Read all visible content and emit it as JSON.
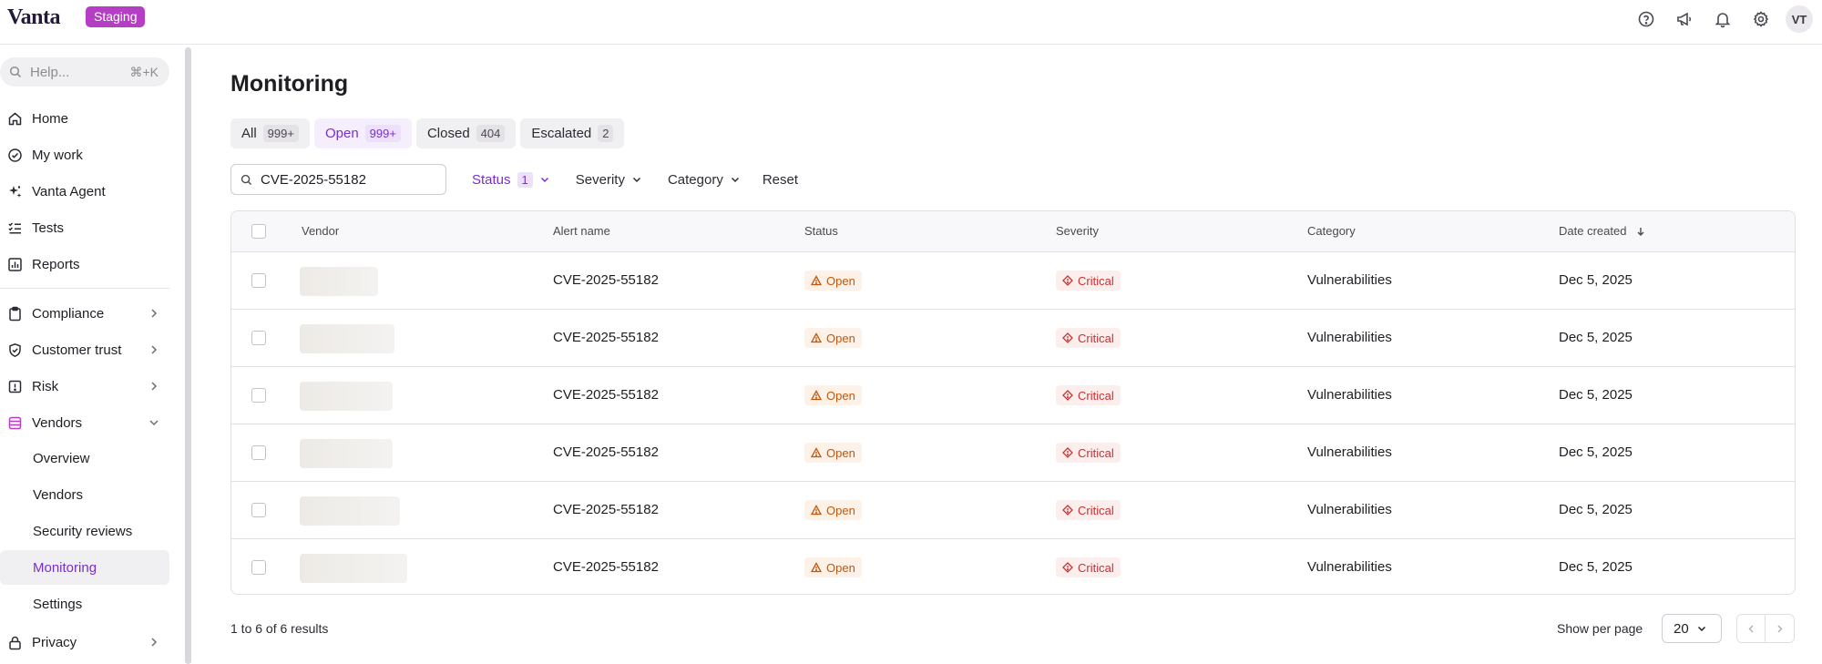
{
  "app": {
    "logo": "Vanta",
    "env_badge": "Staging",
    "avatar_initials": "VT"
  },
  "topbar_icons": [
    "help-icon",
    "megaphone-icon",
    "bell-icon",
    "gear-icon"
  ],
  "sidebar": {
    "search_placeholder": "Help...",
    "search_shortcut": "⌘+K",
    "items": [
      {
        "label": "Home",
        "icon": "home-icon"
      },
      {
        "label": "My work",
        "icon": "check-circle-icon"
      },
      {
        "label": "Vanta Agent",
        "icon": "sparkle-icon"
      },
      {
        "label": "Tests",
        "icon": "list-check-icon"
      },
      {
        "label": "Reports",
        "icon": "chart-icon"
      }
    ],
    "groups": [
      {
        "label": "Compliance",
        "icon": "clipboard-icon"
      },
      {
        "label": "Customer trust",
        "icon": "shield-check-icon"
      },
      {
        "label": "Risk",
        "icon": "alert-square-icon"
      },
      {
        "label": "Vendors",
        "icon": "database-icon"
      }
    ],
    "vendor_sub": [
      "Overview",
      "Vendors",
      "Security reviews",
      "Monitoring",
      "Settings"
    ],
    "active_sub": "Monitoring",
    "privacy": {
      "label": "Privacy",
      "icon": "lock-icon"
    }
  },
  "main": {
    "title": "Monitoring",
    "tabs": [
      {
        "label": "All",
        "count": "999+"
      },
      {
        "label": "Open",
        "count": "999+"
      },
      {
        "label": "Closed",
        "count": "404"
      },
      {
        "label": "Escalated",
        "count": "2"
      }
    ],
    "active_tab": "Open",
    "search_value": "CVE-2025-55182",
    "filters": {
      "status_label": "Status",
      "status_count": "1",
      "severity_label": "Severity",
      "category_label": "Category",
      "reset_label": "Reset"
    },
    "columns": [
      "Vendor",
      "Alert name",
      "Status",
      "Severity",
      "Category",
      "Date created"
    ],
    "rows": [
      {
        "alert": "CVE-2025-55182",
        "status": "Open",
        "severity": "Critical",
        "category": "Vulnerabilities",
        "date": "Dec 5, 2025"
      },
      {
        "alert": "CVE-2025-55182",
        "status": "Open",
        "severity": "Critical",
        "category": "Vulnerabilities",
        "date": "Dec 5, 2025"
      },
      {
        "alert": "CVE-2025-55182",
        "status": "Open",
        "severity": "Critical",
        "category": "Vulnerabilities",
        "date": "Dec 5, 2025"
      },
      {
        "alert": "CVE-2025-55182",
        "status": "Open",
        "severity": "Critical",
        "category": "Vulnerabilities",
        "date": "Dec 5, 2025"
      },
      {
        "alert": "CVE-2025-55182",
        "status": "Open",
        "severity": "Critical",
        "category": "Vulnerabilities",
        "date": "Dec 5, 2025"
      },
      {
        "alert": "CVE-2025-55182",
        "status": "Open",
        "severity": "Critical",
        "category": "Vulnerabilities",
        "date": "Dec 5, 2025"
      }
    ],
    "results_text": "1 to 6 of 6 results",
    "per_page_label": "Show per page",
    "per_page_value": "20"
  },
  "colors": {
    "accent": "#7a2fd0",
    "badge": "#b63ec4",
    "open": "#c2570c",
    "critical": "#c83232"
  }
}
